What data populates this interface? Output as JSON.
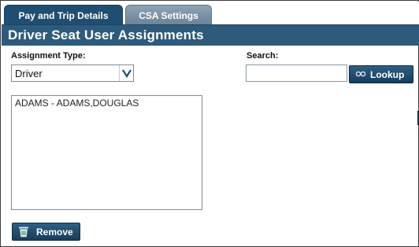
{
  "tabs": [
    {
      "label": "Pay and Trip Details",
      "active": true
    },
    {
      "label": "CSA Settings",
      "active": false
    }
  ],
  "header": {
    "title": "Driver Seat User Assignments"
  },
  "assignment": {
    "label": "Assignment Type:",
    "selected": "Driver"
  },
  "search": {
    "label": "Search:",
    "value": "",
    "placeholder": ""
  },
  "lookup": {
    "label": "Lookup",
    "icon": "search-icon"
  },
  "list": {
    "items": [
      "ADAMS - ADAMS,DOUGLAS"
    ]
  },
  "remove": {
    "label": "Remove",
    "icon": "trash-icon"
  },
  "colors": {
    "active_tab": "#1f4e73",
    "inactive_tab": "#7a92a6",
    "header_bar": "#2e5b7c",
    "button": "#1f4a6b"
  }
}
